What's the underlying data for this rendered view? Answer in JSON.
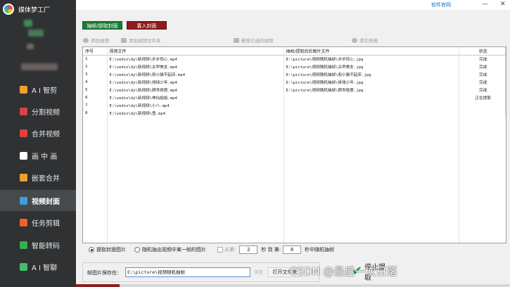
{
  "app": {
    "title": "媒体梦工厂"
  },
  "sidebar": {
    "items": [
      {
        "label": "A I 智剪",
        "icon": "ai-edit-icon",
        "color": "#f0a030"
      },
      {
        "label": "分割视频",
        "icon": "split-icon",
        "color": "#e04040"
      },
      {
        "label": "合并视频",
        "icon": "merge-icon",
        "color": "#e04040"
      },
      {
        "label": "画 中 画",
        "icon": "pip-icon",
        "color": "#ffffff"
      },
      {
        "label": "嵌套合并",
        "icon": "nest-icon",
        "color": "#f0a030"
      },
      {
        "label": "视频封面",
        "icon": "cover-icon",
        "color": "#3aa0e0"
      },
      {
        "label": "任务剪辑",
        "icon": "task-icon",
        "color": "#f06030"
      },
      {
        "label": "智能转码",
        "icon": "transcode-icon",
        "color": "#30b050"
      },
      {
        "label": "A I 智聊",
        "icon": "chat-icon",
        "color": "#40c070"
      }
    ],
    "active_index": 5
  },
  "topbar": {
    "link": "软件官网"
  },
  "toolbar": {
    "extract_label": "抽帧/提取封面",
    "insert_label": "置入封面",
    "add_video": "添加视频",
    "add_folder": "添加视频文件夹",
    "delete_selected": "删除已选的视频",
    "clear_table": "清空表格"
  },
  "table": {
    "headers": [
      "序号",
      "视频文件",
      "抽帧/提取后的图片文件",
      "状态"
    ],
    "rows": [
      {
        "no": "1",
        "video": "E:\\vedio\\dy\\新视频\\步步惊心.mp4",
        "image": "E:\\picture\\视频随机抽帧\\步步惊心.jpg",
        "status": "完成"
      },
      {
        "no": "2",
        "video": "E:\\vedio\\dy\\新视频\\古早美女.mp4",
        "image": "E:\\picture\\视频随机抽帧\\古早美女.jpg",
        "status": "完成"
      },
      {
        "no": "3",
        "video": "E:\\vedio\\dy\\新视频\\和小猫不起床.mp4",
        "image": "E:\\picture\\视频随机抽帧\\和小猫不起床.jpg",
        "status": "完成"
      },
      {
        "no": "4",
        "video": "E:\\vedio\\dy\\新视频\\排球少年.mp4",
        "image": "E:\\picture\\视频随机抽帧\\排球少年.jpg",
        "status": "完成"
      },
      {
        "no": "5",
        "video": "E:\\vedio\\dy\\新视频\\顾世绝唇.mp4",
        "image": "E:\\picture\\视频随机抽帧\\顾世绝唇.jpg",
        "status": "完成"
      },
      {
        "no": "6",
        "video": "E:\\vedio\\dy\\新视频\\神仙姐姐.mp4",
        "image": "",
        "status": "正在提取"
      },
      {
        "no": "7",
        "video": "E:\\vedio\\dy\\新视频\\小八.mp4",
        "image": "",
        "status": ""
      },
      {
        "no": "8",
        "video": "E:\\vedio\\dy\\新视频\\雪.mp4",
        "image": "",
        "status": ""
      }
    ]
  },
  "options": {
    "extract_cover": "提取封面图片",
    "random_frame": "随机抽出视频中某一帧的图片",
    "from_label": "从第:",
    "from_value": "2",
    "sec_to": "秒 到 第:",
    "to_value": "6",
    "sec_random": "秒中随机抽帧"
  },
  "save": {
    "label": "帧图片保存在:",
    "path": "E:\\picture\\视频随机抽帧",
    "browse": "浏览",
    "open_folder": "打开文件夹"
  },
  "actions": {
    "stop_label": "停止提取"
  },
  "watermark": "CSDN @最后一次日落",
  "progress": {
    "fraction": 0.1
  }
}
